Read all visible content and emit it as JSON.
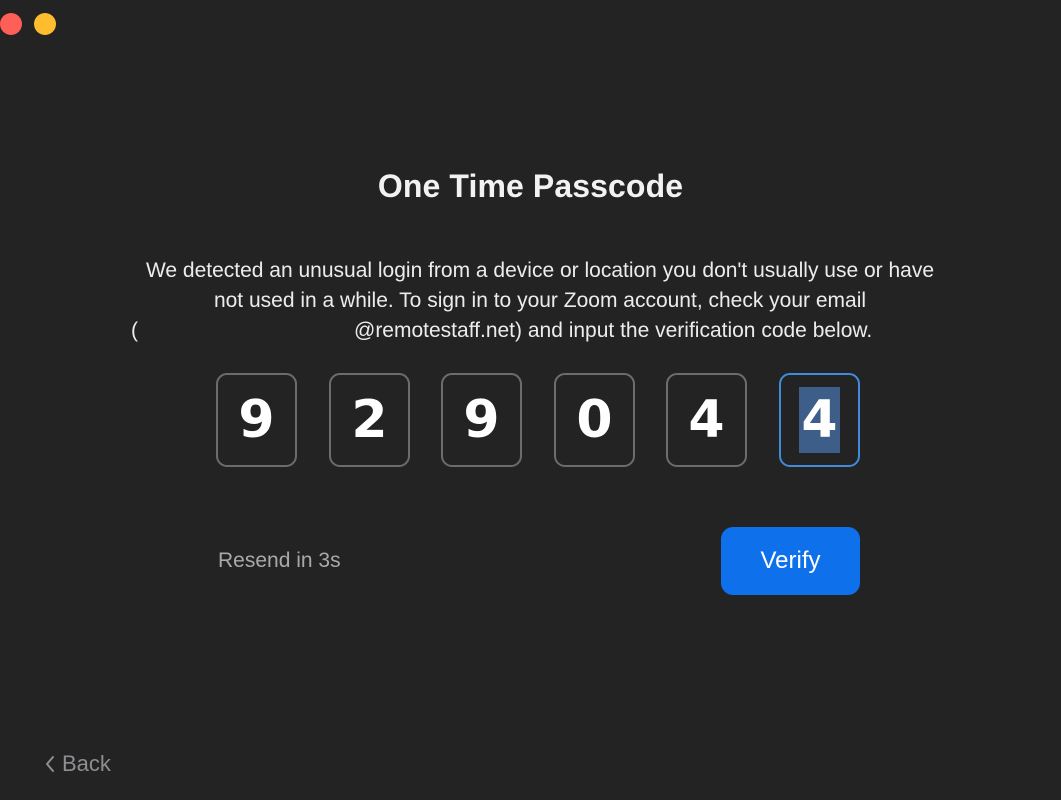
{
  "window": {
    "controls": {
      "close_color": "#fe5f57",
      "minimize_color": "#febc2e"
    }
  },
  "title": "One Time Passcode",
  "description": {
    "line1": "We detected an unusual login from a device or location you don't usually use or have",
    "line2": "not used in a while. To sign in to your Zoom account, check your email",
    "line3_open": "(",
    "line3_rest": "@remotestaff.net) and input the verification code below."
  },
  "code": {
    "digits": [
      "9",
      "2",
      "9",
      "0",
      "4",
      "4"
    ],
    "active_index": 5,
    "active_border_color": "#3f8bdc"
  },
  "resend": {
    "label": "Resend in 3s"
  },
  "verify": {
    "label": "Verify",
    "color": "#0e71eb"
  },
  "back": {
    "icon": "chevron-left-icon",
    "label": "Back"
  }
}
